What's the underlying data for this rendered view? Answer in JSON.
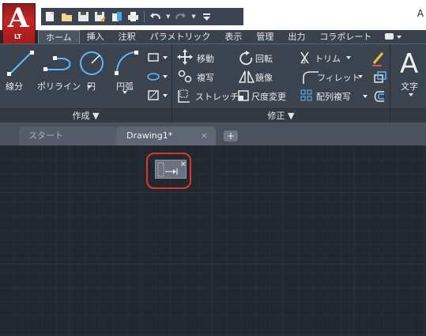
{
  "app": {
    "logo_letter": "A",
    "logo_sub": "LT",
    "title_fragment": "A"
  },
  "tabs": [
    {
      "label": "ホーム",
      "active": true
    },
    {
      "label": "挿入"
    },
    {
      "label": "注釈"
    },
    {
      "label": "パラメトリック"
    },
    {
      "label": "表示"
    },
    {
      "label": "管理"
    },
    {
      "label": "出力"
    },
    {
      "label": "コラボレート"
    }
  ],
  "ribbon": {
    "draw": {
      "title": "作成 ▼",
      "tools": [
        "線分",
        "ポリライン",
        "円",
        "円弧"
      ]
    },
    "modify": {
      "title": "修正 ▼",
      "tools": [
        "移動",
        "回転",
        "トリム",
        "複写",
        "鏡像",
        "フィレット",
        "ストレッチ",
        "尺度変更",
        "配列複写"
      ]
    },
    "annotation": {
      "tools": [
        "文字"
      ]
    }
  },
  "doc_tabs": {
    "start": "スタート",
    "drawing": "Drawing1*",
    "close": "×",
    "add": "+"
  },
  "viewcube": {
    "close": "×"
  },
  "colors": {
    "app_red": "#c62525",
    "highlight": "#e0352a",
    "canvas": "#212830",
    "ribbon": "#3b434e"
  }
}
